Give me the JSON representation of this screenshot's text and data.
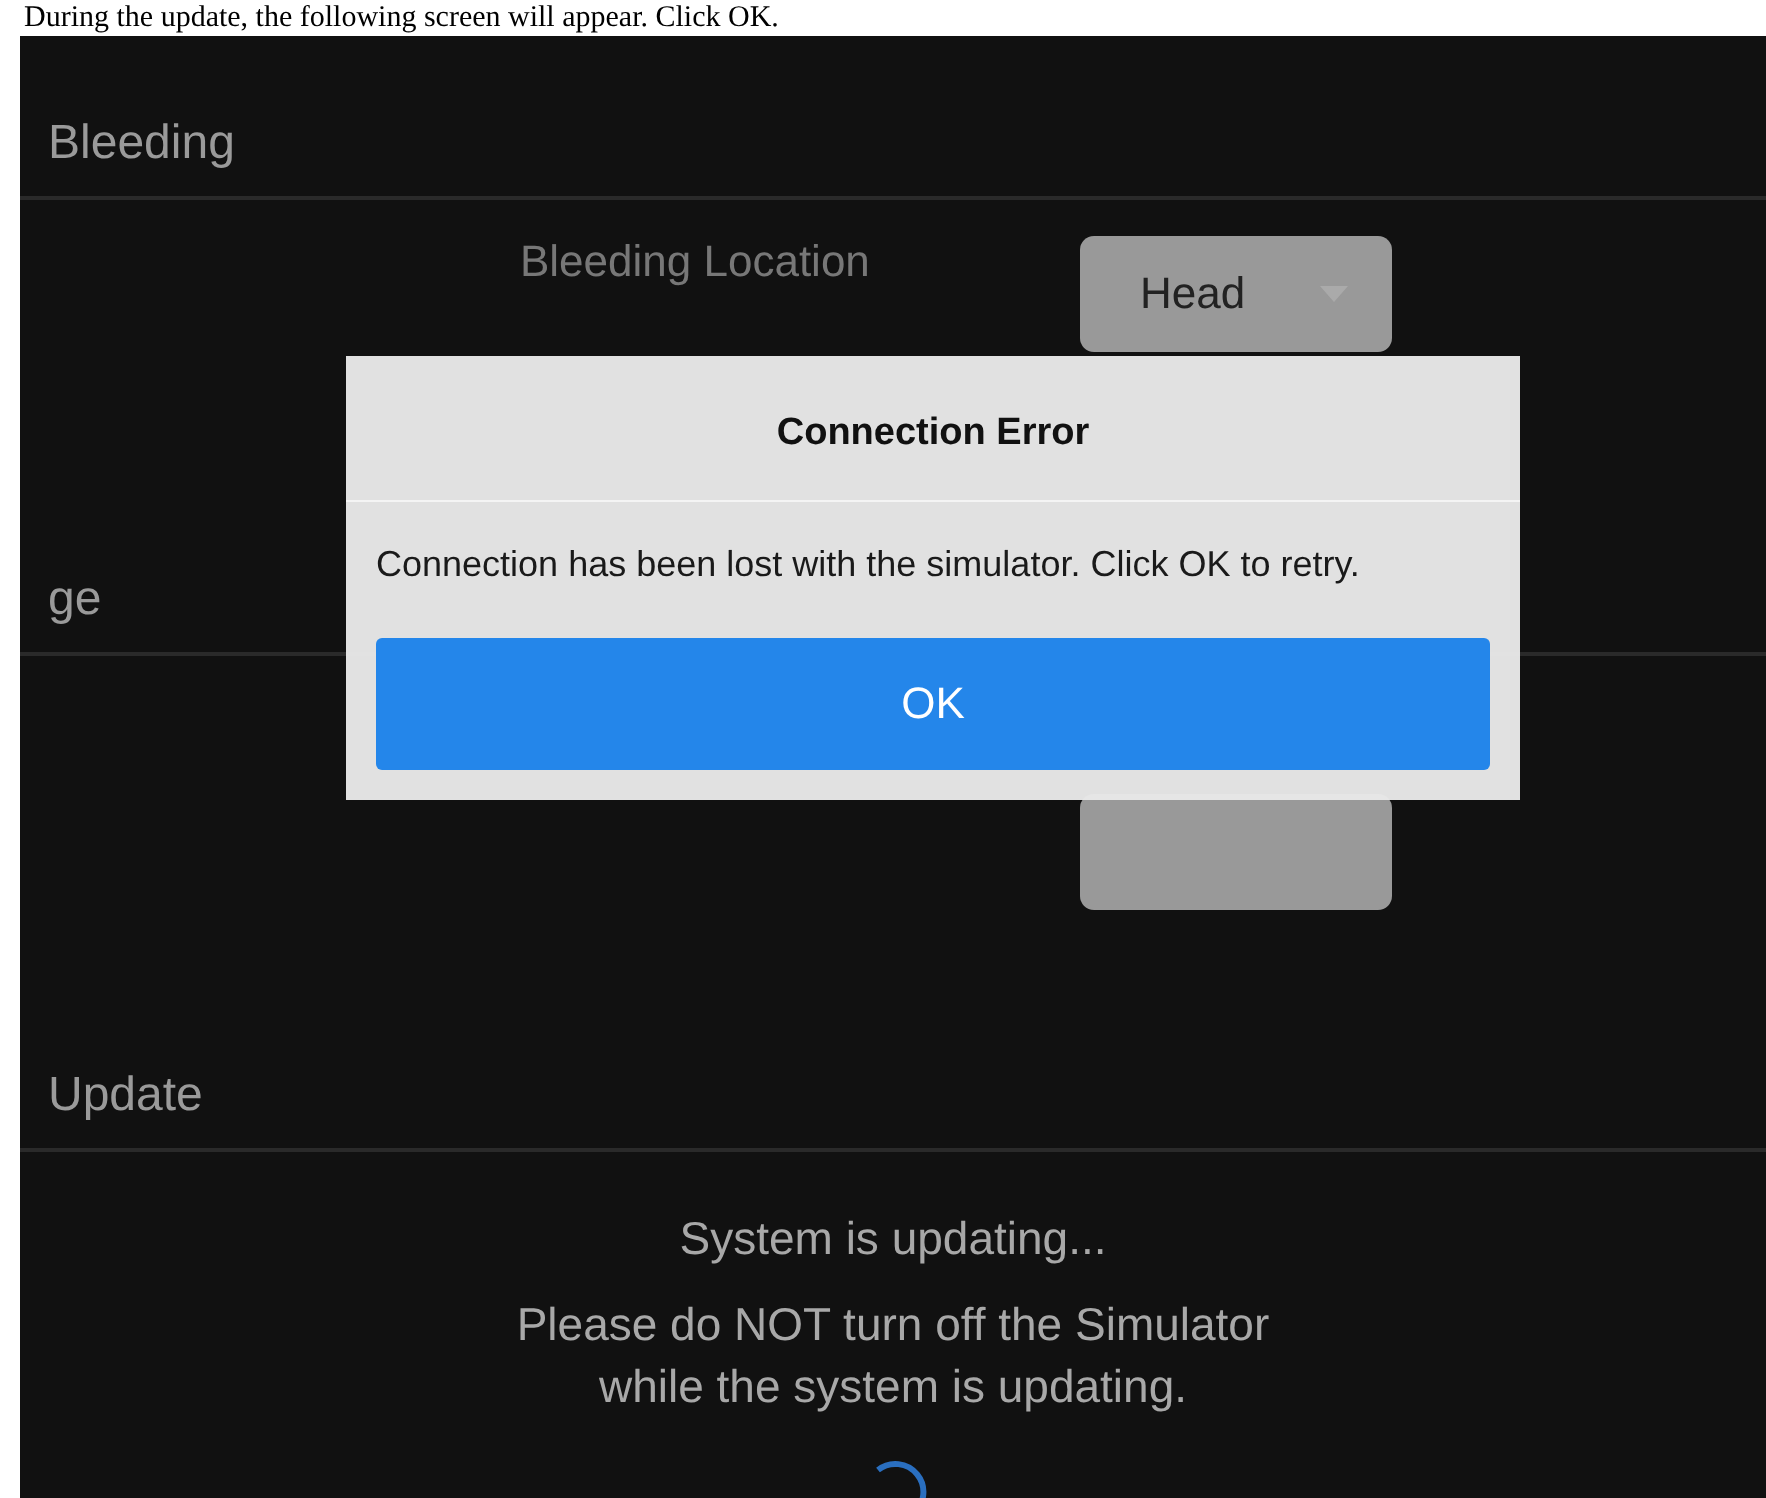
{
  "caption": "During the update, the following screen will appear. Click OK.",
  "sections": [
    {
      "title": "Bleeding",
      "rows": [
        {
          "kind": "dropdown",
          "label": "Bleeding Location",
          "value": "Head"
        }
      ]
    },
    {
      "title": "ge",
      "rows": [
        {
          "kind": "dropdown"
        }
      ]
    },
    {
      "title": "Update",
      "rows": [
        {
          "kind": "status",
          "heading": "System is updating...",
          "message": "Please do NOT turn off the Simulator\nwhile the system is updating.",
          "busy": true
        }
      ]
    }
  ],
  "dialog": {
    "title": "Connection Error",
    "message": "Connection has been lost with the simulator. Click OK to retry.",
    "buttons": [
      "OK"
    ]
  }
}
